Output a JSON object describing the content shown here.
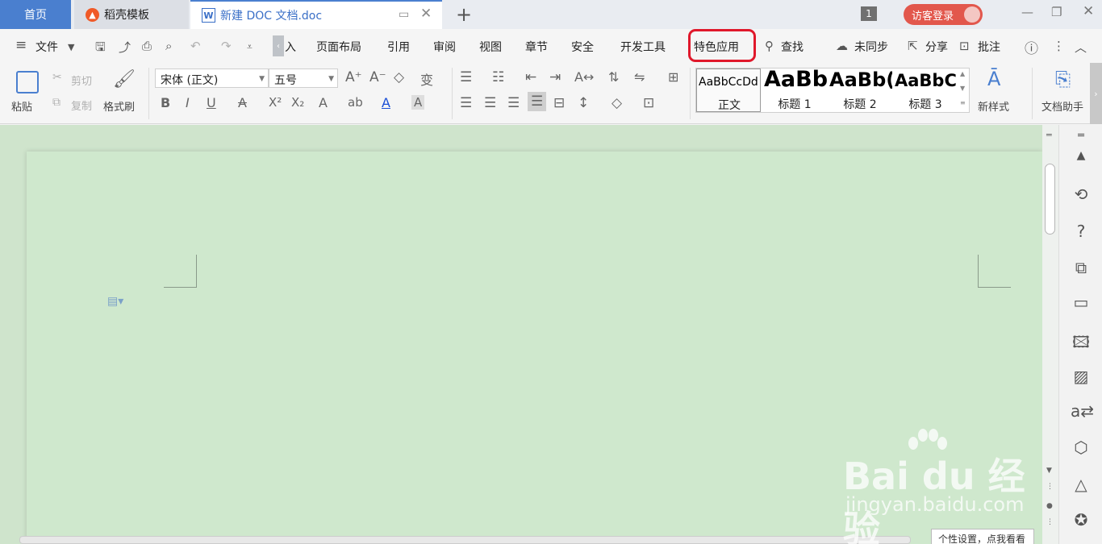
{
  "titlebar": {
    "tabs": [
      {
        "label": "首页"
      },
      {
        "label": "稻壳模板"
      },
      {
        "label": "新建 DOC 文档.doc"
      }
    ],
    "add_tab": "+",
    "window_count": "1",
    "login_label": "访客登录"
  },
  "menubar": {
    "file_label": "文件",
    "items": [
      "入",
      "页面布局",
      "引用",
      "审阅",
      "视图",
      "章节",
      "安全",
      "开发工具",
      "特色应用"
    ],
    "search_label": "查找",
    "sync_label": "未同步",
    "share_label": "分享",
    "comment_label": "批注",
    "highlighted_item": "特色应用",
    "highlight_color": "#e0182b"
  },
  "ribbon": {
    "paste_label": "粘贴",
    "cut_label": "剪切",
    "copy_label": "复制",
    "format_painter_label": "格式刷",
    "font_name": "宋体 (正文)",
    "font_size": "五号",
    "styles": [
      {
        "preview": "AaBbCcDd",
        "name": "正文"
      },
      {
        "preview": "AaBb",
        "name": "标题 1"
      },
      {
        "preview": "AaBb(",
        "name": "标题 2"
      },
      {
        "preview": "AaBbC",
        "name": "标题 3"
      }
    ],
    "new_style_label": "新样式",
    "doc_assistant_label": "文档助手"
  },
  "status": {
    "tooltip": "个性设置，点我看看"
  },
  "watermark": {
    "brand": "Bai du 经验",
    "url": "jingyan.baidu.com"
  },
  "colors": {
    "accent": "#4a7fcf",
    "page_background": "#cfe8cd",
    "login_button": "#e2574c"
  }
}
